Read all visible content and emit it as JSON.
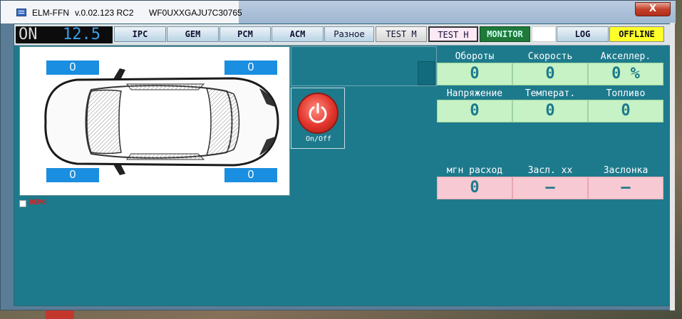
{
  "window": {
    "app_name": "ELM-FFN",
    "version": "v.0.02.123 RC2",
    "vin": "WF0UXXGAJU7C30765",
    "close_label": "X"
  },
  "toolbar": {
    "on_label": "ON",
    "voltage": "12.5",
    "buttons": [
      {
        "label": "IPC"
      },
      {
        "label": "GEM"
      },
      {
        "label": "PCM"
      },
      {
        "label": "ACM"
      },
      {
        "label": "Разное"
      },
      {
        "label": "TEST M"
      },
      {
        "label": "TEST H"
      },
      {
        "label": "MONITOR"
      },
      {
        "label": ""
      },
      {
        "label": "LOG"
      },
      {
        "label": "OFFLINE"
      }
    ]
  },
  "tires": {
    "front_left": "0",
    "front_right": "0",
    "rear_left": "0",
    "rear_right": "0"
  },
  "power": {
    "label": "On/Off"
  },
  "demo": {
    "label": "DEMO",
    "checked": false
  },
  "gauges": {
    "row1": [
      {
        "label": "Обороты",
        "value": "0"
      },
      {
        "label": "Скорость",
        "value": "0"
      },
      {
        "label": "Акселлер.",
        "value": "0 %"
      }
    ],
    "row2": [
      {
        "label": "Напряжение",
        "value": "0"
      },
      {
        "label": "Температ.",
        "value": "0"
      },
      {
        "label": "Топливо",
        "value": "0"
      }
    ],
    "row3": [
      {
        "label": "мгн расход",
        "value": "0"
      },
      {
        "label": "Засл. хх",
        "value": "–"
      },
      {
        "label": "Заслонка",
        "value": "–"
      }
    ]
  },
  "colors": {
    "client_bg": "#1d7a8c",
    "tire_box": "#1a8ee0",
    "gauge_green": "#c6f2c6",
    "gauge_pink": "#f7c9d2",
    "offline": "#ffff2a",
    "monitor": "#1f7a3a"
  },
  "icons": {
    "power": "power-icon",
    "app": "app-window-icon",
    "car": "car-topview-icon"
  }
}
